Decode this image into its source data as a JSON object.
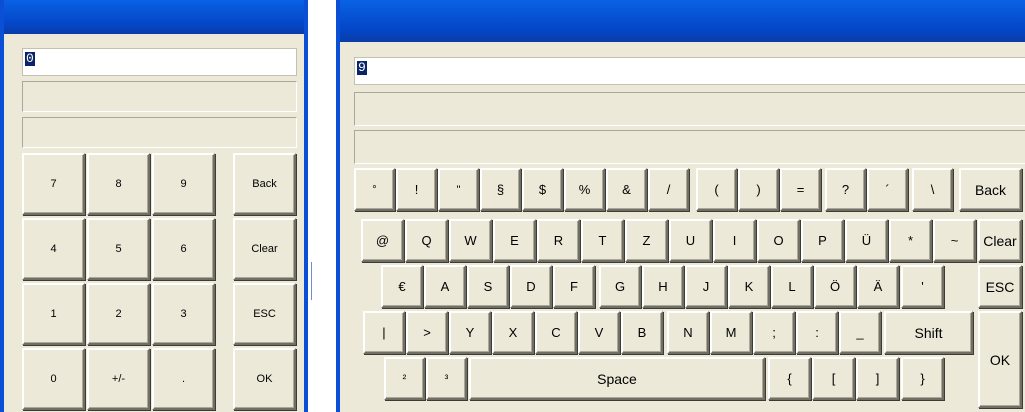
{
  "numpad": {
    "display_value": "0",
    "keys": {
      "k7": "7",
      "k8": "8",
      "k9": "9",
      "back": "Back",
      "k4": "4",
      "k5": "5",
      "k6": "6",
      "clear": "Clear",
      "k1": "1",
      "k2": "2",
      "k3": "3",
      "esc": "ESC",
      "k0": "0",
      "plusminus": "+/-",
      "dot": ".",
      "ok": "OK"
    }
  },
  "keyboard": {
    "display_value": "9",
    "row1": [
      "°",
      "!",
      "\"",
      "§",
      "$",
      "%",
      "&",
      "/",
      "(",
      ")",
      "=",
      "?",
      "´",
      "\\",
      "Back"
    ],
    "row2": [
      "@",
      "Q",
      "W",
      "E",
      "R",
      "T",
      "Z",
      "U",
      "I",
      "O",
      "P",
      "Ü",
      "*",
      "~",
      "Clear"
    ],
    "row3": [
      "€",
      "A",
      "S",
      "D",
      "F",
      "G",
      "H",
      "J",
      "K",
      "L",
      "Ö",
      "Ä",
      "'",
      "ESC"
    ],
    "row4": [
      "|",
      ">",
      "Y",
      "X",
      "C",
      "V",
      "B",
      "N",
      "M",
      ";",
      ":",
      "_",
      "Shift"
    ],
    "row5": [
      "²",
      "³",
      "Space",
      "{",
      "[",
      "]",
      "}"
    ],
    "ok": "OK"
  }
}
